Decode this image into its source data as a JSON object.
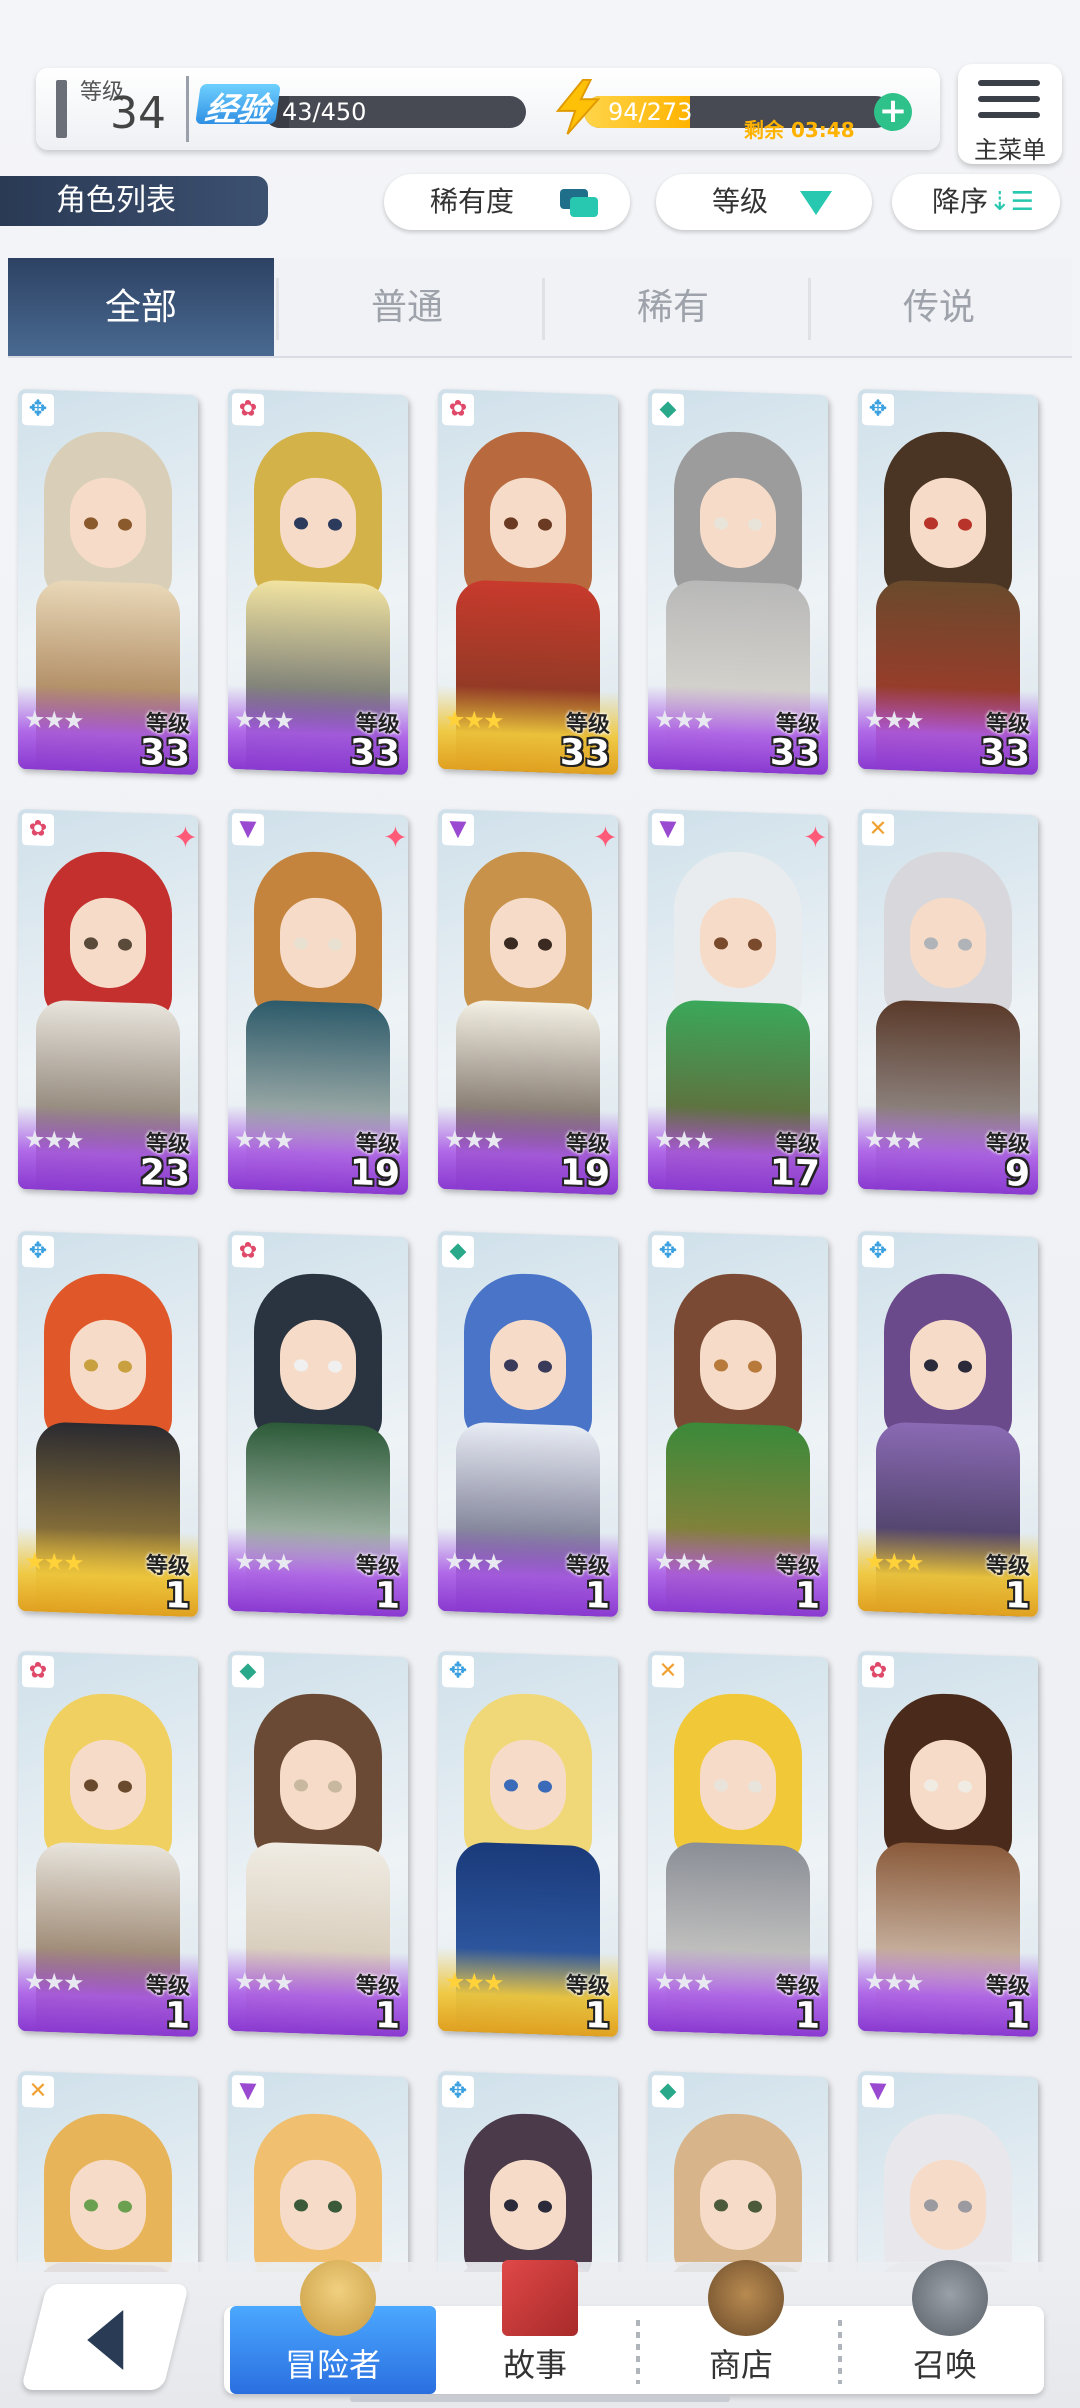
{
  "status": {
    "level_label": "等级",
    "level_value": "34",
    "xp_badge": "经验",
    "xp_text": "43/450",
    "xp_progress": 0.096,
    "stamina_text": "94/273",
    "stamina_progress": 0.344,
    "stamina_remaining": "剩余 03:48",
    "plus": "+"
  },
  "menu": {
    "label": "主菜单"
  },
  "list_tag": "角色列表",
  "filters": {
    "rarity": "稀有度",
    "level": "等级",
    "order": "降序"
  },
  "tabs": [
    "全部",
    "普通",
    "稀有",
    "传说"
  ],
  "active_tab": 0,
  "level_caption": "等级",
  "cards": [
    {
      "element": "wind",
      "level": "33",
      "stars": "silver",
      "rare": false,
      "palette": [
        "#d9cfb8",
        "#e9d8b8",
        "#8a5a2c"
      ]
    },
    {
      "element": "fire",
      "level": "33",
      "stars": "silver",
      "rare": false,
      "palette": [
        "#d4b24a",
        "#f1e3a0",
        "#2c3a5c"
      ]
    },
    {
      "element": "fire",
      "level": "33",
      "stars": "gold",
      "rare": false,
      "palette": [
        "#b86a3e",
        "#c83a2c",
        "#6b3a22"
      ]
    },
    {
      "element": "earth",
      "level": "33",
      "stars": "silver",
      "rare": false,
      "palette": [
        "#9c9c9c",
        "#b8b8b8",
        "#e8e4da"
      ]
    },
    {
      "element": "wind",
      "level": "33",
      "stars": "silver",
      "rare": false,
      "palette": [
        "#4a3424",
        "#6a4a2c",
        "#b8332a"
      ]
    },
    {
      "element": "fire",
      "level": "23",
      "stars": "silver",
      "rare": true,
      "palette": [
        "#c4302e",
        "#e8e4dc",
        "#5a4a3a"
      ]
    },
    {
      "element": "dark",
      "level": "19",
      "stars": "silver",
      "rare": true,
      "palette": [
        "#c4843e",
        "#2c5a6a",
        "#e8e0d0"
      ]
    },
    {
      "element": "dark",
      "level": "19",
      "stars": "silver",
      "rare": true,
      "palette": [
        "#c8924a",
        "#f4f0e4",
        "#3a2a22"
      ]
    },
    {
      "element": "dark",
      "level": "17",
      "stars": "silver",
      "rare": true,
      "palette": [
        "#e8ecee",
        "#3aa85a",
        "#7a4a2c"
      ]
    },
    {
      "element": "light",
      "level": "9",
      "stars": "silver",
      "rare": false,
      "palette": [
        "#d8d8dc",
        "#5a3a2a",
        "#b0b4b8"
      ]
    },
    {
      "element": "wind",
      "level": "1",
      "stars": "gold",
      "rare": false,
      "palette": [
        "#e0582a",
        "#2a2a30",
        "#c8a040"
      ]
    },
    {
      "element": "fire",
      "level": "1",
      "stars": "silver",
      "rare": false,
      "palette": [
        "#2a3440",
        "#2c5a38",
        "#f0f0f0"
      ]
    },
    {
      "element": "earth",
      "level": "1",
      "stars": "silver",
      "rare": false,
      "palette": [
        "#4a74c8",
        "#e8ecf4",
        "#3a3a5a"
      ]
    },
    {
      "element": "wind",
      "level": "1",
      "stars": "silver",
      "rare": false,
      "palette": [
        "#7a4a34",
        "#3a8a3a",
        "#b87a3a"
      ]
    },
    {
      "element": "wind",
      "level": "1",
      "stars": "gold",
      "rare": false,
      "palette": [
        "#6a4a8a",
        "#8a6ab4",
        "#2a2a3a"
      ]
    },
    {
      "element": "fire",
      "level": "1",
      "stars": "silver",
      "rare": false,
      "palette": [
        "#f0d060",
        "#e8e4dc",
        "#6a4a2c"
      ]
    },
    {
      "element": "earth",
      "level": "1",
      "stars": "silver",
      "rare": false,
      "palette": [
        "#6a4a34",
        "#f0ece4",
        "#c8b8a0"
      ]
    },
    {
      "element": "wind",
      "level": "1",
      "stars": "gold",
      "rare": false,
      "palette": [
        "#f0d878",
        "#1a3a7a",
        "#3a6ab8"
      ]
    },
    {
      "element": "light",
      "level": "1",
      "stars": "silver",
      "rare": false,
      "palette": [
        "#f0c838",
        "#8a8e96",
        "#e8e4dc"
      ]
    },
    {
      "element": "fire",
      "level": "1",
      "stars": "silver",
      "rare": false,
      "palette": [
        "#4a2a1a",
        "#8a5a3a",
        "#f0ece4"
      ]
    },
    {
      "element": "light",
      "level": "",
      "stars": "",
      "rare": false,
      "palette": [
        "#e8b45a",
        "#8a3a2a",
        "#6aa050"
      ]
    },
    {
      "element": "dark",
      "level": "",
      "stars": "",
      "rare": false,
      "palette": [
        "#f0c070",
        "#e8d8b0",
        "#3a5a3a"
      ]
    },
    {
      "element": "wind",
      "level": "",
      "stars": "",
      "rare": false,
      "palette": [
        "#4a3a4a",
        "#6a5a6a",
        "#2a2a3a"
      ]
    },
    {
      "element": "earth",
      "level": "",
      "stars": "",
      "rare": false,
      "palette": [
        "#d8b48a",
        "#8a6a4a",
        "#4a5a3a"
      ]
    },
    {
      "element": "dark",
      "level": "",
      "stars": "",
      "rare": false,
      "palette": [
        "#e8e8ec",
        "#c8c8cc",
        "#9a9aa0"
      ]
    }
  ],
  "bottom_nav": {
    "items": [
      "冒险者",
      "故事",
      "商店",
      "召唤"
    ],
    "active": 0
  }
}
